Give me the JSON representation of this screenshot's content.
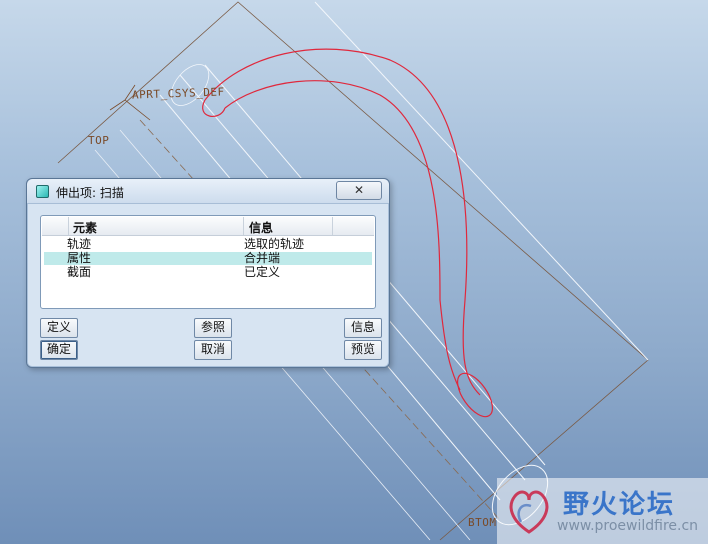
{
  "model": {
    "csys_label": "APRT_CSYS_DEF",
    "top_label": "TOP",
    "bottom_label": "BTOM"
  },
  "dialog": {
    "title": "伸出项: 扫描",
    "close_glyph": "✕",
    "columns": [
      "元素",
      "信息"
    ],
    "rows": [
      {
        "element": "轨迹",
        "info": "选取的轨迹",
        "selected": false
      },
      {
        "element": "属性",
        "info": "合并端",
        "selected": true
      },
      {
        "element": "截面",
        "info": "已定义",
        "selected": false
      }
    ],
    "buttons": {
      "define": "定义",
      "reference": "参照",
      "info": "信息",
      "ok": "确定",
      "cancel": "取消",
      "preview": "预览"
    }
  },
  "watermark": {
    "name": "野火论坛",
    "url": "www.proewildfire.cn"
  },
  "colors": {
    "curve": "#e0283c",
    "edges": "#f2f6fb",
    "datum": "#7a4a28"
  }
}
